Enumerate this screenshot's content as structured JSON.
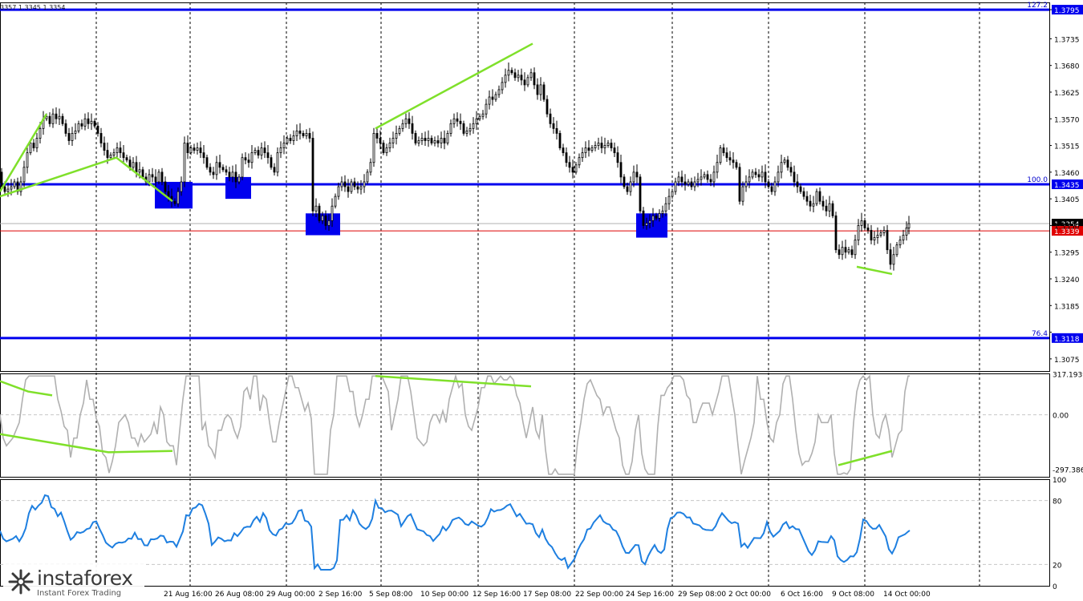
{
  "chart_data": {
    "type": "candlestick",
    "ohlc_text": "3357 1.3345 1.3354",
    "price_axis": {
      "ticks": [
        "1.3795",
        "1.3735",
        "1.3680",
        "1.3625",
        "1.3570",
        "1.3515",
        "1.3460",
        "1.3405",
        "1.3350",
        "1.3295",
        "1.3240",
        "1.3185",
        "1.3130",
        "1.3075"
      ],
      "ylim": [
        1.305,
        1.381
      ]
    },
    "time_axis": {
      "labels": [
        "21 Aug 16:00",
        "26 Aug 08:00",
        "29 Aug 00:00",
        "2 Sep 16:00",
        "5 Sep 08:00",
        "10 Sep 00:00",
        "12 Sep 16:00",
        "17 Sep 08:00",
        "22 Sep 00:00",
        "24 Sep 16:00",
        "29 Sep 08:00",
        "2 Oct 00:00",
        "6 Oct 16:00",
        "9 Oct 08:00",
        "14 Oct 00:00"
      ]
    },
    "levels": [
      {
        "fib": "127.2",
        "price": "1.3795",
        "color": "#0000ee"
      },
      {
        "fib": "100.0",
        "price": "1.3435",
        "color": "#0000ee"
      },
      {
        "fib": "76.4",
        "price": "1.3118",
        "color": "#0000ee"
      }
    ],
    "current_price": {
      "label": "1.3354",
      "value": 1.3354
    },
    "red_line": {
      "label": "1.3339",
      "value": 1.3339
    },
    "price_path": [
      [
        0,
        1.346
      ],
      [
        4,
        1.343
      ],
      [
        8,
        1.342
      ],
      [
        12,
        1.3425
      ],
      [
        16,
        1.343
      ],
      [
        20,
        1.344
      ],
      [
        24,
        1.342
      ],
      [
        28,
        1.344
      ],
      [
        32,
        1.347
      ],
      [
        36,
        1.35
      ],
      [
        40,
        1.352
      ],
      [
        44,
        1.351
      ],
      [
        48,
        1.353
      ],
      [
        52,
        1.355
      ],
      [
        56,
        1.357
      ],
      [
        60,
        1.3575
      ],
      [
        64,
        1.356
      ],
      [
        68,
        1.358
      ],
      [
        72,
        1.357
      ],
      [
        76,
        1.3575
      ],
      [
        80,
        1.356
      ],
      [
        84,
        1.354
      ],
      [
        88,
        1.3525
      ],
      [
        92,
        1.354
      ],
      [
        96,
        1.3545
      ],
      [
        100,
        1.356
      ],
      [
        104,
        1.3555
      ],
      [
        108,
        1.357
      ],
      [
        112,
        1.356
      ],
      [
        116,
        1.3565
      ],
      [
        120,
        1.3555
      ],
      [
        124,
        1.354
      ],
      [
        128,
        1.352
      ],
      [
        132,
        1.3505
      ],
      [
        136,
        1.349
      ],
      [
        140,
        1.3495
      ],
      [
        144,
        1.35
      ],
      [
        148,
        1.351
      ],
      [
        152,
        1.35
      ],
      [
        156,
        1.349
      ],
      [
        160,
        1.3485
      ],
      [
        164,
        1.347
      ],
      [
        168,
        1.348
      ],
      [
        172,
        1.346
      ],
      [
        176,
        1.3465
      ],
      [
        180,
        1.345
      ],
      [
        184,
        1.344
      ],
      [
        188,
        1.3455
      ],
      [
        192,
        1.345
      ],
      [
        196,
        1.344
      ],
      [
        200,
        1.346
      ],
      [
        204,
        1.344
      ],
      [
        208,
        1.342
      ],
      [
        212,
        1.341
      ],
      [
        216,
        1.34
      ],
      [
        220,
        1.3395
      ],
      [
        224,
        1.342
      ],
      [
        228,
        1.344
      ],
      [
        232,
        1.352
      ],
      [
        236,
        1.35
      ],
      [
        240,
        1.351
      ],
      [
        244,
        1.3505
      ],
      [
        248,
        1.351
      ],
      [
        252,
        1.35
      ],
      [
        256,
        1.349
      ],
      [
        260,
        1.347
      ],
      [
        264,
        1.346
      ],
      [
        268,
        1.3455
      ],
      [
        272,
        1.348
      ],
      [
        276,
        1.347
      ],
      [
        280,
        1.3465
      ],
      [
        284,
        1.346
      ],
      [
        288,
        1.345
      ],
      [
        292,
        1.346
      ],
      [
        296,
        1.344
      ],
      [
        300,
        1.345
      ],
      [
        304,
        1.349
      ],
      [
        308,
        1.3485
      ],
      [
        312,
        1.348
      ],
      [
        316,
        1.35
      ],
      [
        320,
        1.3505
      ],
      [
        324,
        1.3495
      ],
      [
        328,
        1.351
      ],
      [
        332,
        1.35
      ],
      [
        336,
        1.349
      ],
      [
        340,
        1.347
      ],
      [
        344,
        1.346
      ],
      [
        348,
        1.35
      ],
      [
        352,
        1.351
      ],
      [
        356,
        1.352
      ],
      [
        360,
        1.353
      ],
      [
        364,
        1.3525
      ],
      [
        368,
        1.3535
      ],
      [
        372,
        1.3545
      ],
      [
        376,
        1.354
      ],
      [
        380,
        1.3535
      ],
      [
        384,
        1.354
      ],
      [
        388,
        1.353
      ],
      [
        392,
        1.338
      ],
      [
        396,
        1.339
      ],
      [
        400,
        1.336
      ],
      [
        404,
        1.337
      ],
      [
        408,
        1.335
      ],
      [
        412,
        1.336
      ],
      [
        416,
        1.339
      ],
      [
        420,
        1.341
      ],
      [
        424,
        1.343
      ],
      [
        428,
        1.344
      ],
      [
        432,
        1.343
      ],
      [
        436,
        1.342
      ],
      [
        440,
        1.344
      ],
      [
        444,
        1.343
      ],
      [
        448,
        1.3425
      ],
      [
        452,
        1.343
      ],
      [
        456,
        1.344
      ],
      [
        460,
        1.346
      ],
      [
        464,
        1.348
      ],
      [
        468,
        1.354
      ],
      [
        472,
        1.353
      ],
      [
        476,
        1.352
      ],
      [
        480,
        1.35
      ],
      [
        484,
        1.351
      ],
      [
        488,
        1.352
      ],
      [
        492,
        1.353
      ],
      [
        496,
        1.354
      ],
      [
        500,
        1.355
      ],
      [
        504,
        1.356
      ],
      [
        508,
        1.357
      ],
      [
        512,
        1.356
      ],
      [
        516,
        1.354
      ],
      [
        520,
        1.352
      ],
      [
        524,
        1.3525
      ],
      [
        528,
        1.353
      ],
      [
        532,
        1.3525
      ],
      [
        536,
        1.353
      ],
      [
        540,
        1.352
      ],
      [
        544,
        1.3525
      ],
      [
        548,
        1.352
      ],
      [
        552,
        1.353
      ],
      [
        556,
        1.352
      ],
      [
        560,
        1.354
      ],
      [
        564,
        1.356
      ],
      [
        568,
        1.357
      ],
      [
        572,
        1.3565
      ],
      [
        576,
        1.356
      ],
      [
        580,
        1.354
      ],
      [
        584,
        1.3545
      ],
      [
        588,
        1.355
      ],
      [
        592,
        1.356
      ],
      [
        596,
        1.357
      ],
      [
        600,
        1.3575
      ],
      [
        604,
        1.358
      ],
      [
        608,
        1.36
      ],
      [
        612,
        1.3615
      ],
      [
        616,
        1.361
      ],
      [
        620,
        1.362
      ],
      [
        624,
        1.363
      ],
      [
        628,
        1.3645
      ],
      [
        632,
        1.366
      ],
      [
        636,
        1.367
      ],
      [
        640,
        1.3665
      ],
      [
        644,
        1.3655
      ],
      [
        648,
        1.366
      ],
      [
        652,
        1.365
      ],
      [
        656,
        1.364
      ],
      [
        660,
        1.3655
      ],
      [
        664,
        1.3665
      ],
      [
        668,
        1.364
      ],
      [
        672,
        1.362
      ],
      [
        676,
        1.364
      ],
      [
        680,
        1.361
      ],
      [
        684,
        1.358
      ],
      [
        688,
        1.356
      ],
      [
        692,
        1.355
      ],
      [
        696,
        1.354
      ],
      [
        700,
        1.351
      ],
      [
        704,
        1.35
      ],
      [
        708,
        1.348
      ],
      [
        712,
        1.347
      ],
      [
        716,
        1.346
      ],
      [
        720,
        1.3475
      ],
      [
        724,
        1.349
      ],
      [
        728,
        1.35
      ],
      [
        732,
        1.351
      ],
      [
        736,
        1.3505
      ],
      [
        740,
        1.351
      ],
      [
        744,
        1.3515
      ],
      [
        748,
        1.352
      ],
      [
        752,
        1.351
      ],
      [
        756,
        1.3515
      ],
      [
        760,
        1.352
      ],
      [
        764,
        1.351
      ],
      [
        768,
        1.35
      ],
      [
        772,
        1.348
      ],
      [
        776,
        1.345
      ],
      [
        780,
        1.343
      ],
      [
        784,
        1.342
      ],
      [
        788,
        1.344
      ],
      [
        792,
        1.346
      ],
      [
        796,
        1.345
      ],
      [
        800,
        1.338
      ],
      [
        804,
        1.335
      ],
      [
        808,
        1.3355
      ],
      [
        812,
        1.336
      ],
      [
        816,
        1.337
      ],
      [
        820,
        1.3365
      ],
      [
        824,
        1.3375
      ],
      [
        828,
        1.338
      ],
      [
        832,
        1.3395
      ],
      [
        836,
        1.341
      ],
      [
        840,
        1.342
      ],
      [
        844,
        1.344
      ],
      [
        848,
        1.345
      ],
      [
        852,
        1.344
      ],
      [
        856,
        1.3435
      ],
      [
        860,
        1.344
      ],
      [
        864,
        1.343
      ],
      [
        868,
        1.344
      ],
      [
        872,
        1.3445
      ],
      [
        876,
        1.345
      ],
      [
        880,
        1.3455
      ],
      [
        884,
        1.3445
      ],
      [
        888,
        1.344
      ],
      [
        892,
        1.346
      ],
      [
        896,
        1.348
      ],
      [
        900,
        1.351
      ],
      [
        904,
        1.35
      ],
      [
        908,
        1.349
      ],
      [
        912,
        1.3485
      ],
      [
        916,
        1.348
      ],
      [
        920,
        1.347
      ],
      [
        924,
        1.34
      ],
      [
        928,
        1.343
      ],
      [
        932,
        1.344
      ],
      [
        936,
        1.345
      ],
      [
        940,
        1.346
      ],
      [
        944,
        1.3455
      ],
      [
        948,
        1.345
      ],
      [
        952,
        1.346
      ],
      [
        956,
        1.344
      ],
      [
        960,
        1.343
      ],
      [
        964,
        1.342
      ],
      [
        968,
        1.344
      ],
      [
        972,
        1.346
      ],
      [
        976,
        1.348
      ],
      [
        980,
        1.3485
      ],
      [
        984,
        1.347
      ],
      [
        988,
        1.346
      ],
      [
        992,
        1.344
      ],
      [
        996,
        1.343
      ],
      [
        1000,
        1.342
      ],
      [
        1004,
        1.341
      ],
      [
        1008,
        1.34
      ],
      [
        1012,
        1.339
      ],
      [
        1016,
        1.3395
      ],
      [
        1020,
        1.342
      ],
      [
        1024,
        1.34
      ],
      [
        1028,
        1.339
      ],
      [
        1032,
        1.338
      ],
      [
        1036,
        1.3395
      ],
      [
        1040,
        1.337
      ],
      [
        1044,
        1.33
      ],
      [
        1048,
        1.329
      ],
      [
        1052,
        1.3305
      ],
      [
        1056,
        1.3295
      ],
      [
        1060,
        1.33
      ],
      [
        1064,
        1.329
      ],
      [
        1068,
        1.332
      ],
      [
        1072,
        1.335
      ],
      [
        1076,
        1.336
      ],
      [
        1080,
        1.3345
      ],
      [
        1084,
        1.334
      ],
      [
        1088,
        1.332
      ],
      [
        1092,
        1.3325
      ],
      [
        1096,
        1.333
      ],
      [
        1100,
        1.3335
      ],
      [
        1104,
        1.334
      ],
      [
        1108,
        1.33
      ],
      [
        1112,
        1.327
      ],
      [
        1116,
        1.329
      ],
      [
        1120,
        1.331
      ],
      [
        1124,
        1.332
      ],
      [
        1128,
        1.333
      ],
      [
        1132,
        1.3345
      ],
      [
        1134,
        1.3354
      ]
    ],
    "trend_lines_main": [
      [
        [
          0,
          1.342
        ],
        [
          58,
          1.358
        ]
      ],
      [
        [
          0,
          1.341
        ],
        [
          145,
          1.349
        ],
        [
          215,
          1.34
        ]
      ],
      [
        [
          468,
          1.355
        ],
        [
          664,
          1.3725
        ]
      ],
      [
        [
          1068,
          1.3265
        ],
        [
          1112,
          1.325
        ]
      ]
    ],
    "highlight_boxes": [
      [
        193,
        240,
        1.3385,
        1.344
      ],
      [
        281,
        313,
        1.3405,
        1.345
      ],
      [
        381,
        424,
        1.333,
        1.3375
      ],
      [
        793,
        832,
        1.3325,
        1.3375
      ]
    ],
    "cci": {
      "ticks": [
        "317.1939",
        "0.00",
        "-297.386"
      ],
      "ylim": [
        -297.386,
        317.1939
      ],
      "divergence_lines": [
        [
          [
            0,
            260
          ],
          [
            35,
            180
          ],
          [
            65,
            150
          ]
        ],
        [
          [
            0,
            -150
          ],
          [
            135,
            -290
          ],
          [
            215,
            -280
          ]
        ],
        [
          [
            468,
            300
          ],
          [
            662,
            220
          ]
        ],
        [
          [
            1045,
            -390
          ],
          [
            1112,
            -280
          ]
        ]
      ]
    },
    "rsi": {
      "ticks": [
        "100",
        "80",
        "20",
        "0"
      ],
      "ylim": [
        0,
        100
      ],
      "guides": [
        80,
        20
      ]
    }
  },
  "watermark": {
    "brand": "instaforex",
    "tagline": "Instant Forex Trading"
  }
}
